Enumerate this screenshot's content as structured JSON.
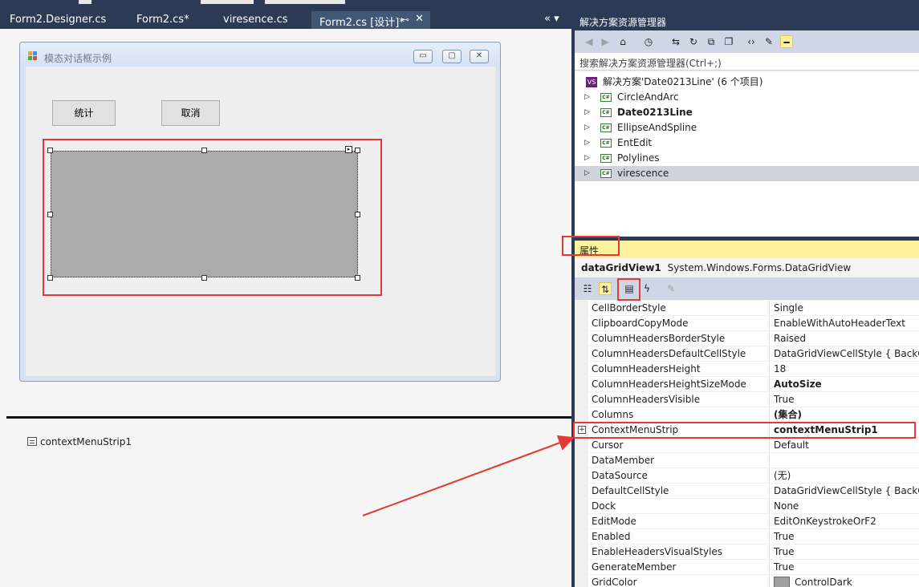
{
  "tabs": [
    {
      "label": "Form2.Designer.cs"
    },
    {
      "label": "Form2.cs*"
    },
    {
      "label": "viresence.cs"
    },
    {
      "label": "Form2.cs [设计]*",
      "active": true
    }
  ],
  "tab_pin_glyph": "⊷",
  "tab_close_glyph": "✕",
  "tab_overflow_glyph": "«  ▾",
  "form": {
    "title": "模态对话框示例",
    "buttons": [
      {
        "label": "统计"
      },
      {
        "label": "取消"
      }
    ],
    "window_buttons": [
      "▭",
      "▢",
      "✕"
    ]
  },
  "tray": {
    "item": "contextMenuStrip1"
  },
  "solution_explorer": {
    "title": "解决方案资源管理器",
    "search_placeholder": "搜索解决方案资源管理器(Ctrl+;)",
    "toolbar_icons": [
      "back-icon",
      "forward-icon",
      "home-icon",
      "history-icon",
      "sync-icon",
      "refresh-icon",
      "collapse-icon",
      "copy-icon",
      "code-icon",
      "wrench-icon",
      "pin-icon"
    ],
    "solution": "解决方案'Date0213Line' (6 个项目)",
    "projects": [
      {
        "name": "CircleAndArc",
        "bold": false,
        "selected": false
      },
      {
        "name": "Date0213Line",
        "bold": true,
        "selected": false
      },
      {
        "name": "EllipseAndSpline",
        "bold": false,
        "selected": false
      },
      {
        "name": "EntEdit",
        "bold": false,
        "selected": false
      },
      {
        "name": "Polylines",
        "bold": false,
        "selected": false
      },
      {
        "name": "virescence",
        "bold": false,
        "selected": true
      }
    ]
  },
  "properties": {
    "title": "属性",
    "object_name": "dataGridView1",
    "object_type": "System.Windows.Forms.DataGridView",
    "rows": [
      {
        "name": "CellBorderStyle",
        "value": "Single"
      },
      {
        "name": "ClipboardCopyMode",
        "value": "EnableWithAutoHeaderText"
      },
      {
        "name": "ColumnHeadersBorderStyle",
        "value": "Raised"
      },
      {
        "name": "ColumnHeadersDefaultCellStyle",
        "value": "DataGridViewCellStyle { BackCo"
      },
      {
        "name": "ColumnHeadersHeight",
        "value": "18"
      },
      {
        "name": "ColumnHeadersHeightSizeMode",
        "value": "AutoSize",
        "bold": true
      },
      {
        "name": "ColumnHeadersVisible",
        "value": "True"
      },
      {
        "name": "Columns",
        "value": "(集合)",
        "bold": true
      },
      {
        "name": "ContextMenuStrip",
        "value": "contextMenuStrip1",
        "bold": true,
        "expandable": true
      },
      {
        "name": "Cursor",
        "value": "Default"
      },
      {
        "name": "DataMember",
        "value": ""
      },
      {
        "name": "DataSource",
        "value": "(无)"
      },
      {
        "name": "DefaultCellStyle",
        "value": "DataGridViewCellStyle { BackCo"
      },
      {
        "name": "Dock",
        "value": "None"
      },
      {
        "name": "EditMode",
        "value": "EditOnKeystrokeOrF2"
      },
      {
        "name": "Enabled",
        "value": "True"
      },
      {
        "name": "EnableHeadersVisualStyles",
        "value": "True"
      },
      {
        "name": "GenerateMember",
        "value": "True"
      },
      {
        "name": "GridColor",
        "value": "ControlDark",
        "swatch": "#a0a0a0"
      }
    ]
  },
  "colors": {
    "ide_chrome": "#2b3a55",
    "active_tab": "#405875",
    "highlight_red": "#e53935",
    "properties_header": "#fff29d"
  }
}
